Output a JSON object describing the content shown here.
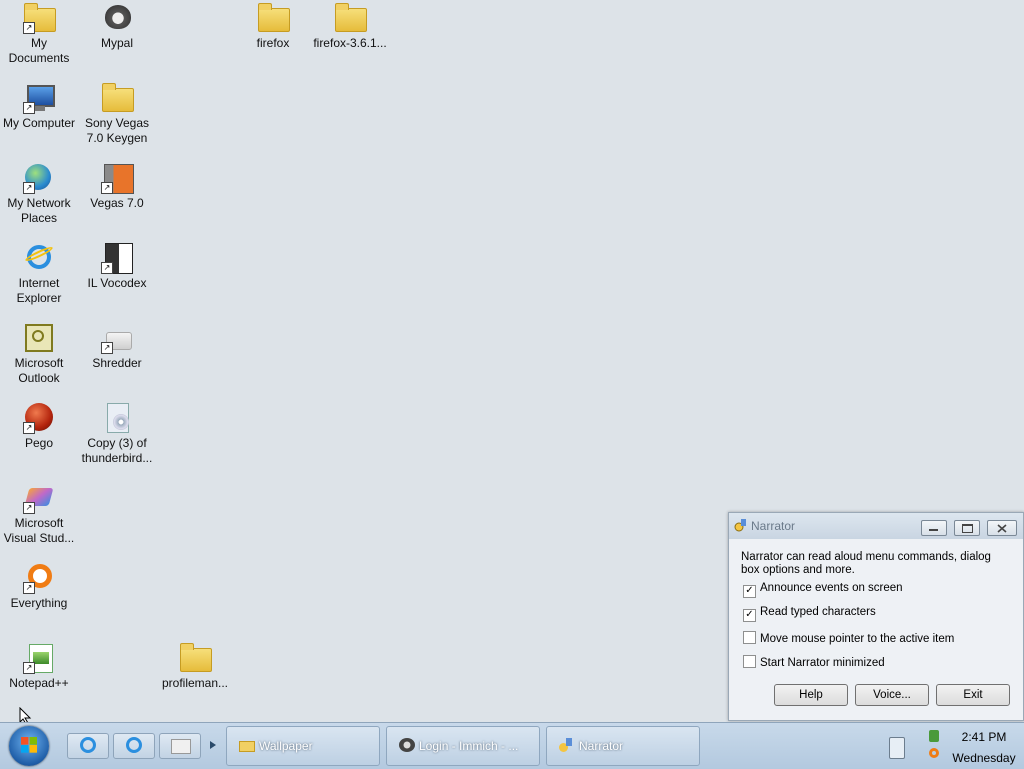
{
  "desktop": {
    "icons": [
      {
        "label": "My Documents"
      },
      {
        "label": "Mypal"
      },
      {
        "label": "firefox"
      },
      {
        "label": "firefox-3.6.1..."
      },
      {
        "label": "My Computer"
      },
      {
        "label": "Sony Vegas 7.0 Keygen"
      },
      {
        "label": "My Network Places"
      },
      {
        "label": "Vegas 7.0"
      },
      {
        "label": "Internet Explorer"
      },
      {
        "label": "IL Vocodex"
      },
      {
        "label": "Microsoft Outlook"
      },
      {
        "label": "Shredder"
      },
      {
        "label": "Pego"
      },
      {
        "label": "Copy (3) of thunderbird..."
      },
      {
        "label": "Microsoft Visual Stud..."
      },
      {
        "label": "Everything"
      },
      {
        "label": "Notepad++"
      },
      {
        "label": "profileman..."
      }
    ]
  },
  "narrator": {
    "title": "Narrator",
    "description": "Narrator can read aloud menu commands, dialog box options and more.",
    "options": [
      {
        "label": "Announce events on screen",
        "checked": true
      },
      {
        "label": "Read typed characters",
        "checked": true
      },
      {
        "label": "Move mouse pointer to the active item",
        "checked": false
      },
      {
        "label": "Start Narrator minimized",
        "checked": false
      }
    ],
    "buttons": {
      "help": "Help",
      "voice": "Voice...",
      "exit": "Exit"
    }
  },
  "taskbar": {
    "tasks": [
      {
        "label": "Wallpaper"
      },
      {
        "label": "Login - Immich - ..."
      },
      {
        "label": "Narrator"
      }
    ],
    "clock": {
      "time": "2:41 PM",
      "day": "Wednesday"
    }
  },
  "colors": {
    "desktop": "#dde3e8",
    "taskbar": "#bcd0e4",
    "accent": "#1f5ea8"
  }
}
